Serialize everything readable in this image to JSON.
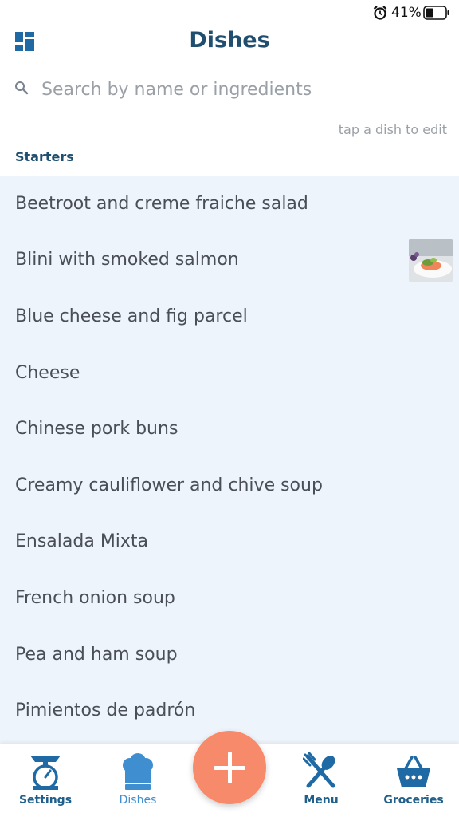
{
  "status_bar": {
    "battery_percent": "41%",
    "battery_level": 0.41
  },
  "header": {
    "title": "Dishes",
    "layout_icon": "dashboard-grid-icon"
  },
  "search": {
    "placeholder": "Search by name or ingredients",
    "value": ""
  },
  "hint": "tap a dish to edit",
  "section": {
    "title": "Starters"
  },
  "dishes": [
    "Beetroot and creme fraiche salad",
    "Blini with smoked salmon",
    "Blue cheese and fig parcel",
    "Cheese",
    "Chinese pork buns",
    "Creamy cauliflower and chive soup",
    "Ensalada Mixta",
    "French onion soup",
    "Pea and ham soup",
    "Pimientos de padrón"
  ],
  "nav": {
    "settings": "Settings",
    "dishes": "Dishes",
    "menu": "Menu",
    "groceries": "Groceries"
  },
  "colors": {
    "title": "#1f4e6e",
    "list_background": "#eef4fb",
    "fab": "#f78a6a",
    "nav_active": "#3f8fd0",
    "nav_inactive": "#1f5f8a"
  }
}
